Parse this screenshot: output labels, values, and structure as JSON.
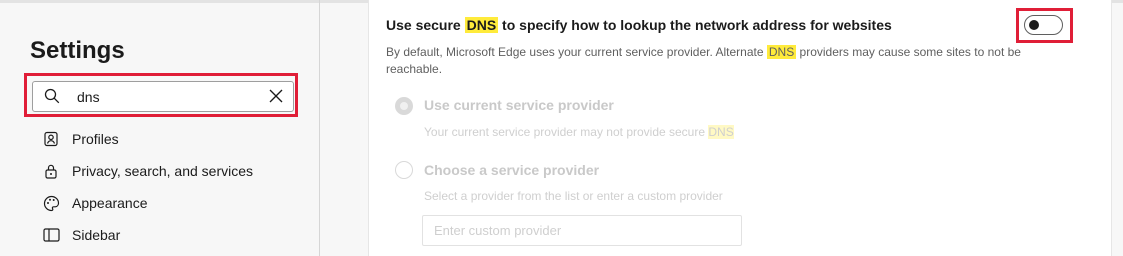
{
  "sidebar": {
    "title": "Settings",
    "search": {
      "value": "dns",
      "placeholder": ""
    },
    "items": [
      {
        "label": "Profiles",
        "icon": "profile-icon"
      },
      {
        "label": "Privacy, search, and services",
        "icon": "lock-icon"
      },
      {
        "label": "Appearance",
        "icon": "palette-icon"
      },
      {
        "label": "Sidebar",
        "icon": "sidebar-icon"
      }
    ]
  },
  "setting": {
    "title_pre": "Use secure ",
    "title_hl": "DNS",
    "title_post": " to specify how to lookup the network address for websites",
    "desc_pre": "By default, Microsoft Edge uses your current service provider. Alternate ",
    "desc_hl": "DNS",
    "desc_post": " providers may cause some sites to not be reachable.",
    "toggle_on": false,
    "options": [
      {
        "label": "Use current service provider",
        "sub_pre": "Your current service provider may not provide secure ",
        "sub_hl": "DNS",
        "selected": true
      },
      {
        "label": "Choose a service provider",
        "sub_pre": "Select a provider from the list or enter a custom provider",
        "sub_hl": "",
        "selected": false
      }
    ],
    "custom_provider_placeholder": "Enter custom provider"
  },
  "colors": {
    "highlight": "#ffeb3b",
    "focus_outline": "#e01e37",
    "disabled_text": "#c9c9c9"
  }
}
